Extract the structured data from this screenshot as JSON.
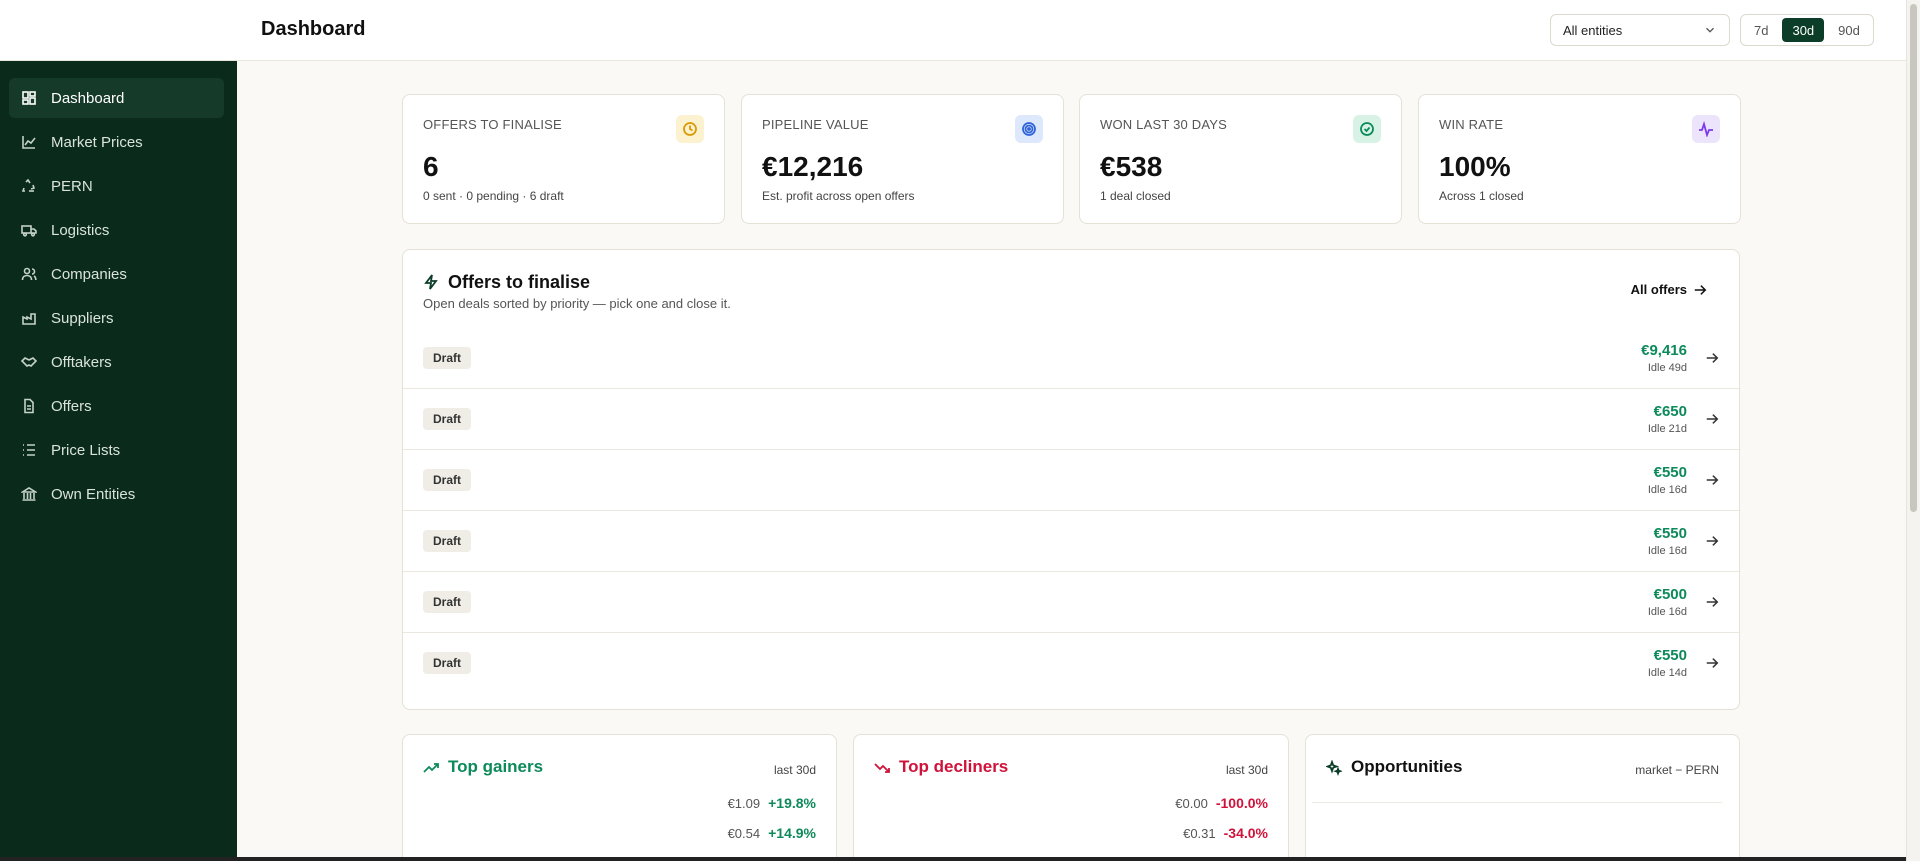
{
  "header": {
    "title": "Dashboard",
    "entity_select": "All entities",
    "ranges": [
      "7d",
      "30d",
      "90d"
    ],
    "active_range": "30d"
  },
  "sidebar": {
    "items": [
      {
        "label": "Dashboard",
        "icon": "dashboard-icon",
        "active": true
      },
      {
        "label": "Market Prices",
        "icon": "chart-line-icon"
      },
      {
        "label": "PERN",
        "icon": "recycle-icon"
      },
      {
        "label": "Logistics",
        "icon": "truck-icon"
      },
      {
        "label": "Companies",
        "icon": "users-icon"
      },
      {
        "label": "Suppliers",
        "icon": "factory-icon"
      },
      {
        "label": "Offtakers",
        "icon": "handshake-icon"
      },
      {
        "label": "Offers",
        "icon": "document-icon"
      },
      {
        "label": "Price Lists",
        "icon": "list-icon"
      },
      {
        "label": "Own Entities",
        "icon": "bank-icon"
      }
    ]
  },
  "stats": [
    {
      "label": "OFFERS TO FINALISE",
      "value": "6",
      "sub": "0 sent · 0 pending · 6 draft",
      "icon": "clock-icon",
      "color": "#d99a06",
      "bg": "#fdf2d0"
    },
    {
      "label": "PIPELINE VALUE",
      "value": "€12,216",
      "sub": "Est. profit across open offers",
      "icon": "target-icon",
      "color": "#2f63d8",
      "bg": "#dde8fc"
    },
    {
      "label": "WON LAST 30 DAYS",
      "value": "€538",
      "sub": "1 deal closed",
      "icon": "check-circle-icon",
      "color": "#0d8a5a",
      "bg": "#d8f3e6"
    },
    {
      "label": "WIN RATE",
      "value": "100%",
      "sub": "Across 1 closed",
      "icon": "activity-icon",
      "color": "#7c3aed",
      "bg": "#ece4fb"
    }
  ],
  "offers": {
    "title": "Offers to finalise",
    "subtitle": "Open deals sorted by priority — pick one and close it.",
    "all_label": "All offers",
    "rows": [
      {
        "status": "Draft",
        "amount": "€9,416",
        "idle": "Idle 49d"
      },
      {
        "status": "Draft",
        "amount": "€650",
        "idle": "Idle 21d"
      },
      {
        "status": "Draft",
        "amount": "€550",
        "idle": "Idle 16d"
      },
      {
        "status": "Draft",
        "amount": "€550",
        "idle": "Idle 16d"
      },
      {
        "status": "Draft",
        "amount": "€500",
        "idle": "Idle 16d"
      },
      {
        "status": "Draft",
        "amount": "€550",
        "idle": "Idle 14d"
      }
    ]
  },
  "gainers": {
    "title": "Top gainers",
    "meta": "last 30d",
    "rows": [
      {
        "price": "€1.09",
        "pct": "+19.8%"
      },
      {
        "price": "€0.54",
        "pct": "+14.9%"
      }
    ]
  },
  "decliners": {
    "title": "Top decliners",
    "meta": "last 30d",
    "rows": [
      {
        "price": "€0.00",
        "pct": "-100.0%"
      },
      {
        "price": "€0.31",
        "pct": "-34.0%"
      }
    ]
  },
  "opportunities": {
    "title": "Opportunities",
    "meta": "market − PERN"
  }
}
